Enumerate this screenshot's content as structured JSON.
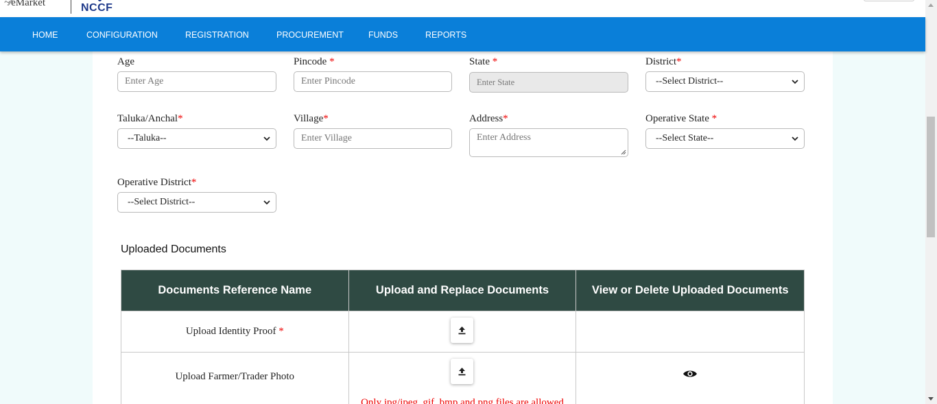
{
  "header": {
    "logo_emarket": "eMarket",
    "logo_nccf": "NCCF"
  },
  "nav": {
    "items": [
      {
        "label": "HOME"
      },
      {
        "label": "CONFIGURATION"
      },
      {
        "label": "REGISTRATION"
      },
      {
        "label": "PROCUREMENT"
      },
      {
        "label": "FUNDS"
      },
      {
        "label": "REPORTS"
      }
    ]
  },
  "form": {
    "age": {
      "label": "Age",
      "placeholder": "Enter Age"
    },
    "pincode": {
      "label": "Pincode",
      "placeholder": "Enter Pincode",
      "required": "*"
    },
    "state": {
      "label": "State",
      "placeholder": "Enter State",
      "required": "*"
    },
    "district": {
      "label": "District",
      "value": "--Select District--",
      "required": "*"
    },
    "taluka": {
      "label": "Taluka/Anchal",
      "value": "--Taluka--",
      "required": "*"
    },
    "village": {
      "label": "Village",
      "placeholder": "Enter Village",
      "required": "*"
    },
    "address": {
      "label": "Address",
      "placeholder": "Enter Address",
      "required": "*"
    },
    "operative_state": {
      "label": "Operative State",
      "value": "--Select State--",
      "required": "*"
    },
    "operative_district": {
      "label": "Operative District",
      "value": "--Select District--",
      "required": "*"
    }
  },
  "documents": {
    "title": "Uploaded Documents",
    "columns": [
      "Documents Reference Name",
      "Upload and Replace Documents",
      "View or Delete Uploaded Documents"
    ],
    "rows": [
      {
        "name": "Upload Identity Proof",
        "required": "*"
      },
      {
        "name": "Upload Farmer/Trader Photo",
        "note": "Only jpg/jpeg, gif, bmp and png files are allowed"
      }
    ]
  },
  "colors": {
    "nav_bg": "#0a7fd9",
    "table_header_bg": "#2f4a43",
    "required": "#ee0000",
    "page_bg": "#f0fbfb"
  },
  "icons": [
    "upload-icon",
    "eye-icon",
    "chevron-down-icon"
  ]
}
